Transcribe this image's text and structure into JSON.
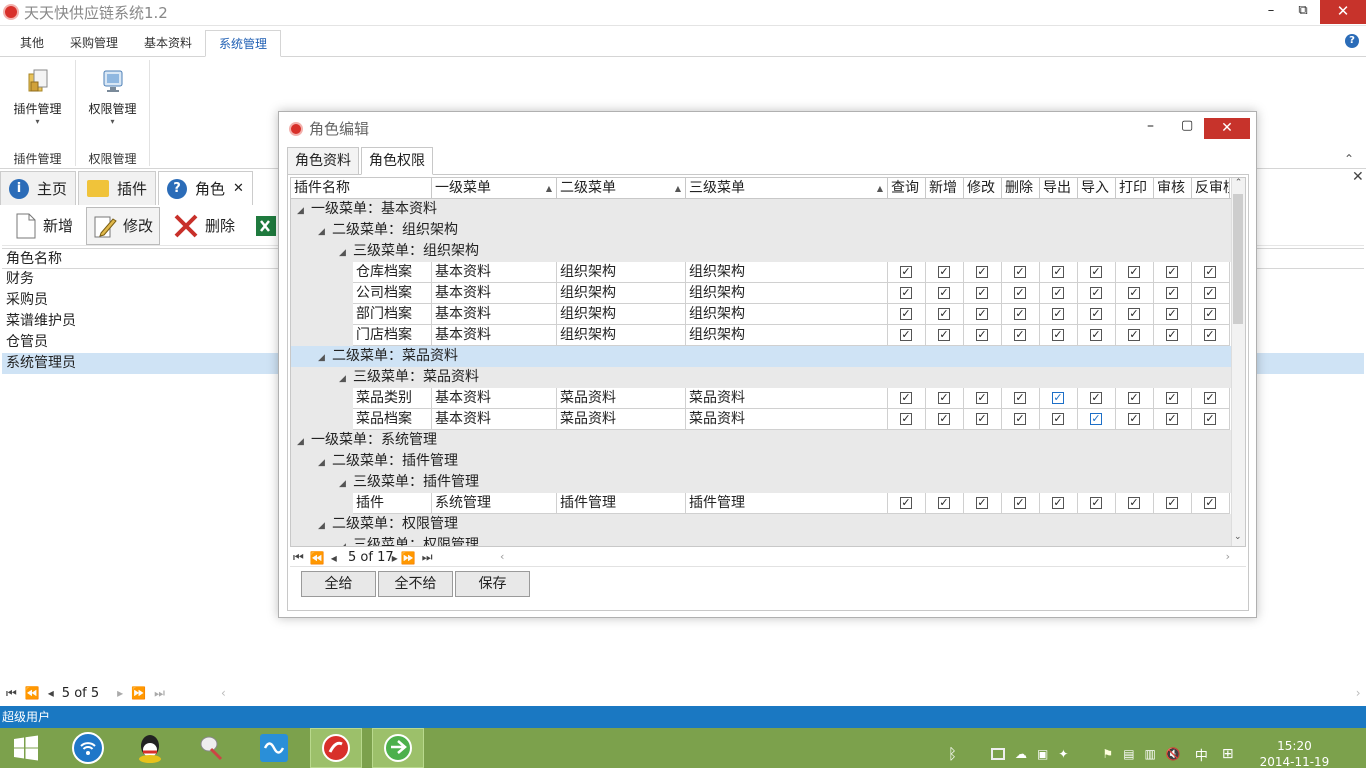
{
  "window": {
    "title": "天天快供应链系统1.2",
    "minimize": "–",
    "maximize": "⧉",
    "close": "✕"
  },
  "ribbon": {
    "tabs": [
      "其他",
      "采购管理",
      "基本资料",
      "系统管理"
    ],
    "active_tab": 3,
    "help": "?",
    "groups": [
      {
        "button": "插件管理",
        "caption": "插件管理",
        "icon": "plugin-icon"
      },
      {
        "button": "权限管理",
        "caption": "权限管理",
        "icon": "monitor-icon"
      }
    ],
    "collapse": "⌃"
  },
  "doc_tabs": [
    {
      "label": "主页",
      "icon": "info-icon",
      "color": "#2b6cb8"
    },
    {
      "label": "插件",
      "icon": "folder-icon",
      "color": "#f0c33a"
    },
    {
      "label": "角色",
      "icon": "help-icon",
      "color": "#2b6cb8",
      "close": "✕"
    }
  ],
  "toolbar": {
    "new": "新增",
    "edit": "修改",
    "delete": "删除"
  },
  "roles": {
    "header": "角色名称",
    "rows": [
      "财务",
      "采购员",
      "菜谱维护员",
      "仓管员",
      "系统管理员"
    ],
    "selected": 4,
    "pager": "5 of 5"
  },
  "status": {
    "user": "超级用户"
  },
  "taskbar": {
    "time": "15:20",
    "date": "2014-11-19",
    "ime": "中"
  },
  "dialog": {
    "title": "角色编辑",
    "tabs": [
      "角色资料",
      "角色权限"
    ],
    "active_tab": 1,
    "columns": [
      "插件名称",
      "一级菜单",
      "二级菜单",
      "三级菜单"
    ],
    "perm_columns": [
      "查询",
      "新增",
      "修改",
      "删除",
      "导出",
      "导入",
      "打印",
      "审核",
      "反审核"
    ],
    "rows": [
      {
        "type": "g1",
        "label": "一级菜单：基本资料"
      },
      {
        "type": "g2",
        "label": "二级菜单：组织架构"
      },
      {
        "type": "g3",
        "label": "三级菜单：组织架构"
      },
      {
        "type": "d",
        "cells": [
          "仓库档案",
          "基本资料",
          "组织架构",
          "组织架构"
        ]
      },
      {
        "type": "d",
        "cells": [
          "公司档案",
          "基本资料",
          "组织架构",
          "组织架构"
        ]
      },
      {
        "type": "d",
        "cells": [
          "部门档案",
          "基本资料",
          "组织架构",
          "组织架构"
        ]
      },
      {
        "type": "d",
        "cells": [
          "门店档案",
          "基本资料",
          "组织架构",
          "组织架构"
        ]
      },
      {
        "type": "g2",
        "label": "二级菜单：菜品资料",
        "selected": true
      },
      {
        "type": "g3",
        "label": "三级菜单：菜品资料"
      },
      {
        "type": "d",
        "cells": [
          "菜品类别",
          "基本资料",
          "菜品资料",
          "菜品资料"
        ],
        "hl": [
          4
        ]
      },
      {
        "type": "d",
        "cells": [
          "菜品档案",
          "基本资料",
          "菜品资料",
          "菜品资料"
        ],
        "hl": [
          5
        ]
      },
      {
        "type": "g1",
        "label": "一级菜单：系统管理"
      },
      {
        "type": "g2",
        "label": "二级菜单：插件管理"
      },
      {
        "type": "g3",
        "label": "三级菜单：插件管理"
      },
      {
        "type": "d",
        "cells": [
          "插件",
          "系统管理",
          "插件管理",
          "插件管理"
        ]
      },
      {
        "type": "g2",
        "label": "二级菜单：权限管理"
      },
      {
        "type": "g3",
        "label": "三级菜单：权限管理"
      }
    ],
    "pager": "5 of 17",
    "buttons": [
      "全给",
      "全不给",
      "保存"
    ]
  }
}
